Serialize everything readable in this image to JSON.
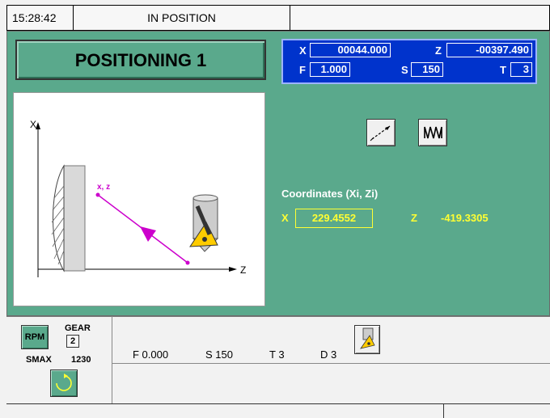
{
  "topbar": {
    "time": "15:28:42",
    "status": "IN POSITION"
  },
  "title": "POSITIONING 1",
  "readout": {
    "x_label": "X",
    "x_value": "00044.000",
    "z_label": "Z",
    "z_value": "-00397.490",
    "f_label": "F",
    "f_value": "1.000",
    "s_label": "S",
    "s_value": "150",
    "t_label": "T",
    "t_value": "3"
  },
  "illustration": {
    "axis_x": "X",
    "axis_z": "Z",
    "point_label": "x, z"
  },
  "icons": {
    "linear_move": "linear-move-icon",
    "thread": "thread-icon",
    "tool": "tool-icon",
    "spindle_rotation": "spindle-rotation-icon"
  },
  "coordinates": {
    "title": "Coordinates  (Xi, Zi)",
    "x_label": "X",
    "x_value": "229.4552",
    "z_label": "Z",
    "z_value": "-419.3305"
  },
  "spindle": {
    "rpm_label": "RPM",
    "gear_label": "GEAR",
    "gear_value": "2",
    "smax_label": "SMAX",
    "smax_value": "1230"
  },
  "status_line": {
    "f": "F  0.000",
    "s": "S  150",
    "t": "T  3",
    "d": "D  3"
  },
  "colors": {
    "panel_green": "#5aa98c",
    "readout_blue": "#0033cc",
    "highlight_yellow": "#ffff33",
    "path_magenta": "#cc00cc"
  }
}
